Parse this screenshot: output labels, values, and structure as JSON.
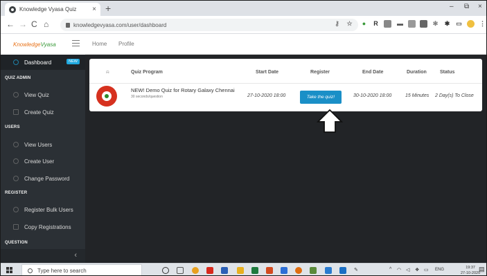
{
  "browser": {
    "tab_title": "Knowledge Vyasa Quiz",
    "tab_close": "×",
    "new_tab": "+",
    "url": "knowledgevyasa.com/user/dashboard",
    "window_controls": [
      "–",
      "⧉",
      "×"
    ]
  },
  "header": {
    "brand_part1": "Knowledge",
    "brand_part2": "Vyasa",
    "nav": [
      "Home",
      "Profile"
    ]
  },
  "sidebar": {
    "dashboard": "Dashboard",
    "badge": "NEW",
    "sections": {
      "quiz_admin": "QUIZ ADMIN",
      "users": "USERS",
      "register": "REGISTER",
      "question": "QUESTION"
    },
    "items": {
      "view_quiz": "View Quiz",
      "create_quiz": "Create Quiz",
      "view_users": "View Users",
      "create_user": "Create User",
      "change_password": "Change Password",
      "register_bulk_users": "Register Bulk Users",
      "copy_registrations": "Copy Registrations"
    },
    "collapse_icon": "‹"
  },
  "table": {
    "columns": [
      "Quiz Program",
      "Start Date",
      "Register",
      "End Date",
      "Duration",
      "Status"
    ],
    "row": {
      "title": "NEW! Demo Quiz for Rotary Galaxy Chennai",
      "subtitle": "30 seconds/question",
      "start_date": "27-10-2020 18:00",
      "register_button": "Take the quiz!",
      "end_date": "30-10-2020 18:00",
      "duration": "15 Minutes",
      "status": "2 Day(s) To Close"
    }
  },
  "taskbar": {
    "search_placeholder": "Type here to search",
    "lang": "ENG",
    "time": "19:37",
    "date": "27-10-2020"
  },
  "colors": {
    "sidebar_bg": "#2b3035",
    "main_bg": "#222427",
    "button": "#1a8fc7",
    "badge": "#20a9df",
    "brand_orange": "#e8731a",
    "brand_green": "#3a9a3a"
  }
}
